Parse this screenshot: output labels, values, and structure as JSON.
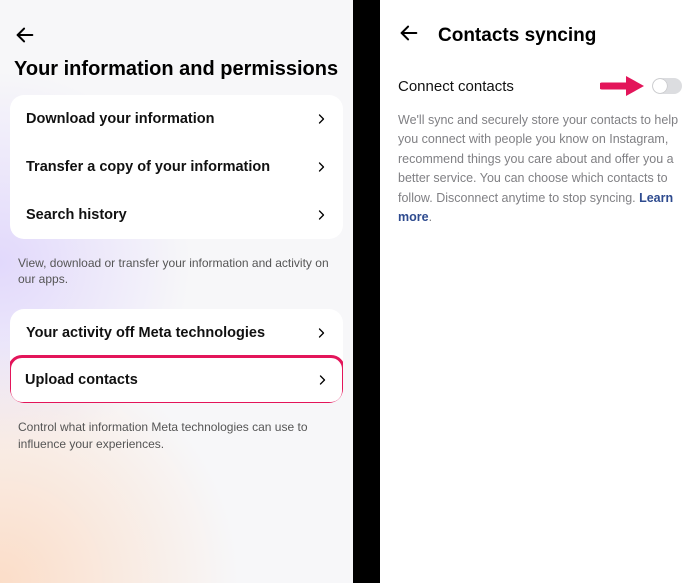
{
  "left": {
    "title": "Your information and permissions",
    "group1": {
      "items": [
        {
          "label": "Download your information"
        },
        {
          "label": "Transfer a copy of your information"
        },
        {
          "label": "Search history"
        }
      ],
      "caption": "View, download or transfer your information and activity on our apps."
    },
    "group2": {
      "items": [
        {
          "label": "Your activity off Meta technologies"
        },
        {
          "label": "Upload contacts"
        }
      ],
      "caption": "Control what information Meta technologies can use to influence your experiences."
    }
  },
  "right": {
    "title": "Contacts syncing",
    "toggle_label": "Connect contacts",
    "toggle_state": "off",
    "description": "We'll sync and securely store your contacts to help you connect with people you know on Instagram, recommend things you care about and offer you a better service. You can choose which contacts to follow. Disconnect anytime to stop syncing. ",
    "learn_more": "Learn more"
  },
  "colors": {
    "highlight": "#e3155a"
  }
}
